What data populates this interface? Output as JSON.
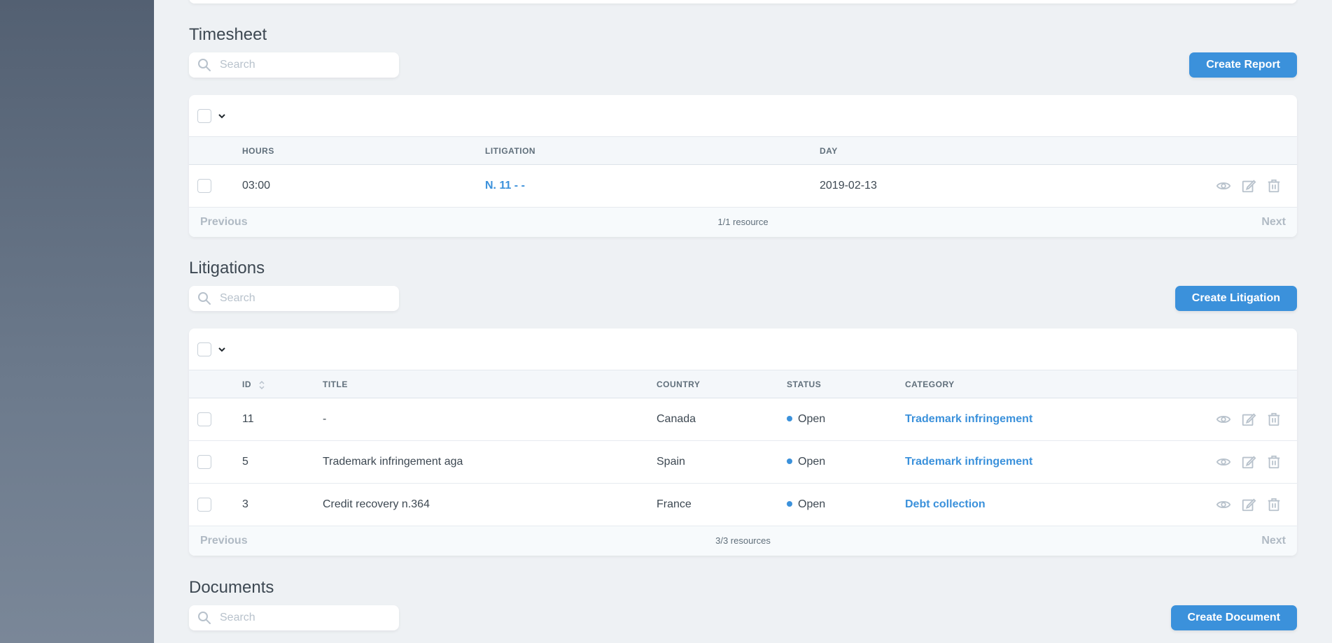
{
  "timesheet": {
    "title": "Timesheet",
    "search_placeholder": "Search",
    "create_button": "Create Report",
    "columns": [
      "HOURS",
      "LITIGATION",
      "DAY"
    ],
    "rows": [
      {
        "hours": "03:00",
        "litigation": "N. 11 - -",
        "day": "2019-02-13"
      }
    ],
    "pager": {
      "prev": "Previous",
      "count": "1/1 resource",
      "next": "Next"
    }
  },
  "litigations": {
    "title": "Litigations",
    "search_placeholder": "Search",
    "create_button": "Create Litigation",
    "columns": [
      "ID",
      "TITLE",
      "COUNTRY",
      "STATUS",
      "CATEGORY"
    ],
    "rows": [
      {
        "id": "11",
        "title": "-",
        "country": "Canada",
        "status": "Open",
        "category": "Trademark infringement"
      },
      {
        "id": "5",
        "title": "Trademark infringement aga",
        "country": "Spain",
        "status": "Open",
        "category": "Trademark infringement"
      },
      {
        "id": "3",
        "title": "Credit recovery n.364",
        "country": "France",
        "status": "Open",
        "category": "Debt collection"
      }
    ],
    "pager": {
      "prev": "Previous",
      "count": "3/3 resources",
      "next": "Next"
    }
  },
  "documents": {
    "title": "Documents",
    "search_placeholder": "Search",
    "create_button": "Create Document"
  },
  "colors": {
    "accent": "#3b91db",
    "sidebar": "#5f6c7e",
    "background": "#eef1f4"
  }
}
